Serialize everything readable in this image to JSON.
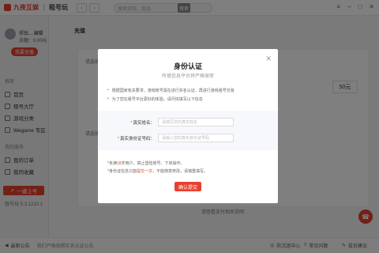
{
  "topbar": {
    "logo_text": "九夜互娱",
    "logo_sub": "租号玩",
    "back_icon": "‹",
    "forward_icon": "›",
    "search_placeholder": "搜索游戏、商品",
    "search_btn": "搜索",
    "window_icons": [
      "≡",
      "–",
      "□",
      "✕"
    ]
  },
  "sidebar": {
    "user_name": "祁钛... 编辑",
    "balance": "余额：0.00元",
    "recharge": "我要充值",
    "section1": "推荐",
    "items1": [
      "首页",
      "租号大厅",
      "游戏分类",
      "Wegame 专区"
    ],
    "section2": "我的服务",
    "items2": [
      "我的订单",
      "我的收藏"
    ],
    "upload": "一键上号",
    "version": "租号玩 5.3.1210.1"
  },
  "main": {
    "title": "充值",
    "label_top": "请选择",
    "label_mid": "请选择",
    "amount": "50元",
    "bottom_hint": "请查看支付相关说明"
  },
  "bottombar": {
    "announcement_label": "最新公告",
    "announcement_text": "我们严格按照实名认证公告",
    "help": "防沉迷中心",
    "faq": "常见问题",
    "complaint": "投诉建议"
  },
  "modal": {
    "title": "身份认证",
    "subtitle": "所填信息平台将严格保密",
    "notice1": "根据国家有关要求，游戏账号需在进行实名认证，再进行游戏租号交易",
    "notice2": "为了您在租号平台更好的体验，请尽快填写以下信息",
    "name_label": "真实姓名：",
    "name_placeholder": "请填写您的真实姓名",
    "id_label": "真实身份证号码：",
    "id_placeholder": "请输入您的真实身份证号码",
    "foot1_a": "*未满",
    "foot1_red": "18",
    "foot1_b": "岁用户，禁止登陆账号、下单操作。",
    "foot2_a": "*身份证信息只能",
    "foot2_red": "提交一次",
    "foot2_b": "，不能随意修改，请慎重填写。",
    "submit": "确认提交",
    "close_icon": "✕"
  }
}
